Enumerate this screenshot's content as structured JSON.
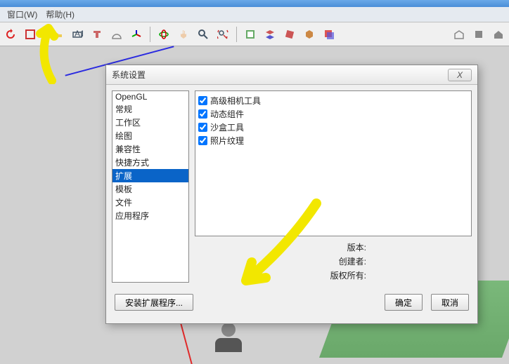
{
  "menubar": {
    "window": "窗口(W)",
    "help": "帮助(H)"
  },
  "toolbar": {
    "icons": [
      "refresh",
      "new-doc",
      "tape",
      "dim",
      "text",
      "protractor",
      "axes",
      "orbit",
      "pan",
      "zoom",
      "zoom-ext",
      "outliner",
      "layers",
      "section",
      "walk",
      "styles",
      "shadows"
    ],
    "right_icons": [
      "warehouse",
      "components",
      "home"
    ]
  },
  "dialog": {
    "title": "系统设置",
    "categories": [
      "OpenGL",
      "常规",
      "工作区",
      "绘图",
      "兼容性",
      "快捷方式",
      "扩展",
      "模板",
      "文件",
      "应用程序"
    ],
    "selected_index": 6,
    "extensions": [
      {
        "label": "高级相机工具",
        "checked": true
      },
      {
        "label": "动态组件",
        "checked": true
      },
      {
        "label": "沙盒工具",
        "checked": true
      },
      {
        "label": "照片纹理",
        "checked": true
      }
    ],
    "meta": {
      "version_label": "版本:",
      "creator_label": "创建者:",
      "copyright_label": "版权所有:"
    },
    "buttons": {
      "install": "安装扩展程序...",
      "ok": "确定",
      "cancel": "取消"
    },
    "close": "X"
  }
}
